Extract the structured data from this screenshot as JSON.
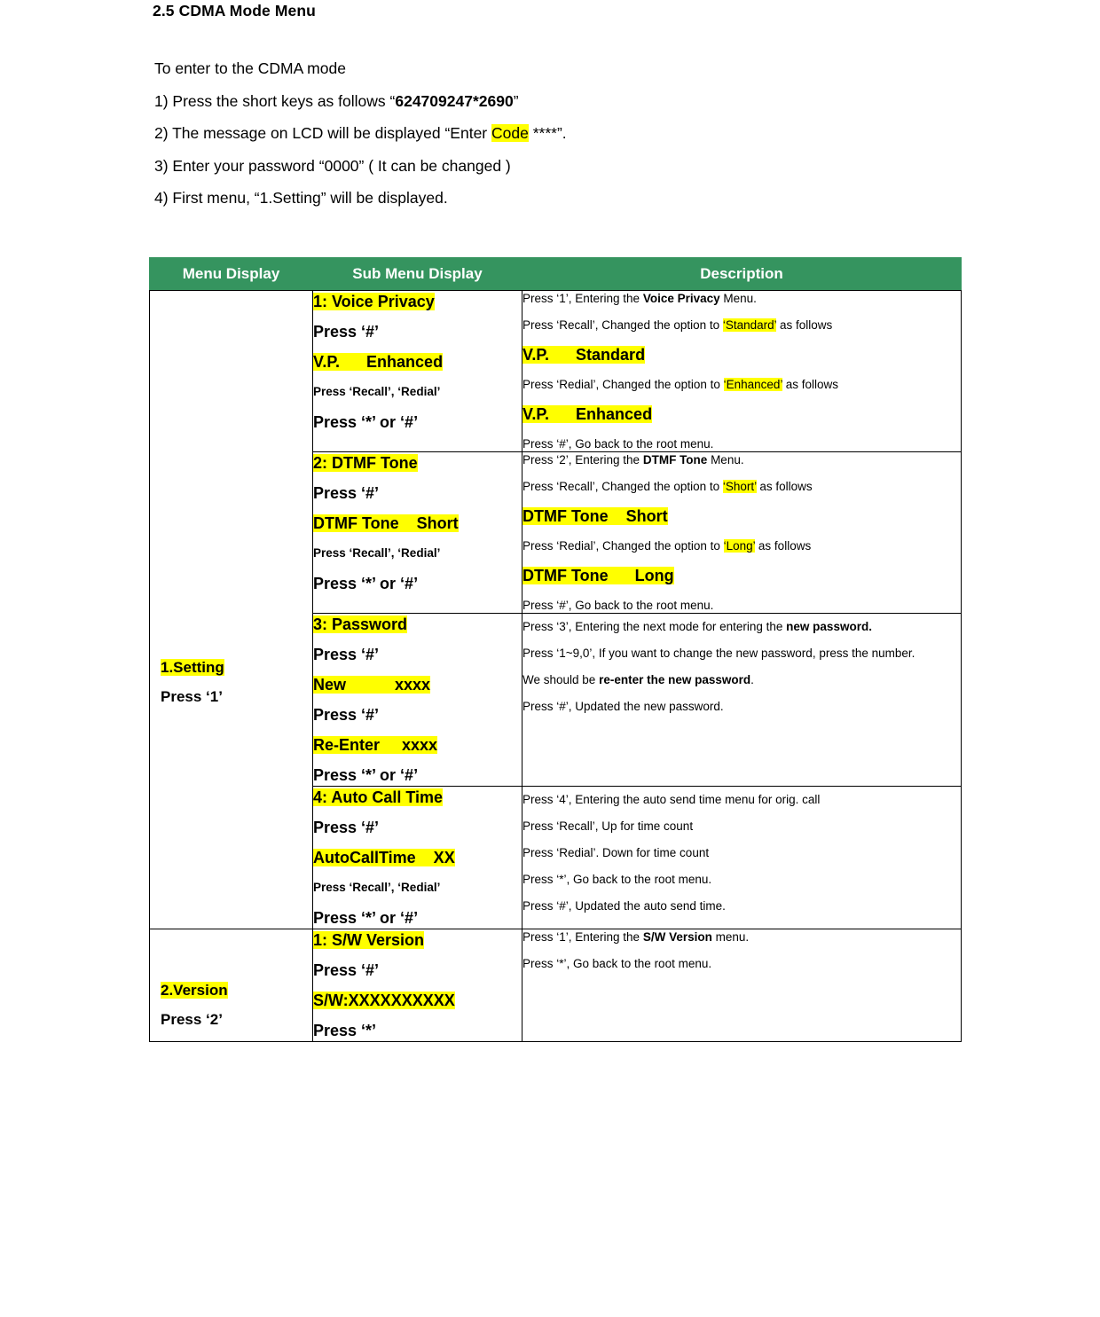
{
  "document": {
    "heading": "2.5 CDMA Mode Menu",
    "intro": {
      "line0": "To enter to the CDMA mode",
      "line1_pre": "1) Press the short keys as follows “",
      "line1_bold": "624709247*2690",
      "line1_post": "”",
      "line2_pre": "2) The message on LCD will be displayed “Enter ",
      "line2_hl": "Code",
      "line2_post": " ****”.",
      "line3": "3) Enter your password “0000” ( It can be changed )",
      "line4": "4) First menu, “1.Setting” will be displayed."
    }
  },
  "table": {
    "headers": {
      "menu": "Menu Display",
      "sub": "Sub Menu Display",
      "desc": "Description"
    },
    "colors": {
      "header_green": "#35945f",
      "highlight_yellow": "#ffff00",
      "border": "#000000"
    },
    "groups": [
      {
        "menu_name": "1.Setting",
        "menu_press": "Press ‘1’",
        "rows": [
          {
            "sub": {
              "l1": "1: Voice Privacy",
              "l2": "Press ‘#’",
              "l3": "V.P.      Enhanced",
              "l4": "Press ‘Recall’, ‘Redial’",
              "l5": "Press ‘*’ or ‘#’"
            },
            "desc": {
              "d1_pre": "Press ‘1’, Entering the ",
              "d1_bold": "Voice Privacy",
              "d1_post": " Menu.",
              "d2_pre": "Press ‘Recall’, Changed the option to ",
              "d2_hl": "‘Standard’",
              "d2_post": " as follows",
              "d3": "V.P.      Standard",
              "d4_pre": "Press ‘Redial’, Changed the option to ",
              "d4_hl": "‘Enhanced’",
              "d4_post": " as follows",
              "d5": "V.P.      Enhanced",
              "d6": "Press ‘#’, Go back to the root menu."
            }
          },
          {
            "sub": {
              "l1": "2: DTMF Tone",
              "l2": "Press ‘#’",
              "l3": "DTMF Tone    Short",
              "l4": "Press ‘Recall’, ‘Redial’",
              "l5": "Press ‘*’ or ‘#’"
            },
            "desc": {
              "d1_pre": "Press ‘2’, Entering the ",
              "d1_bold": "DTMF Tone",
              "d1_post": " Menu.",
              "d2_pre": "Press ‘Recall’, Changed the option to ",
              "d2_hl": "‘Short’",
              "d2_post": " as follows",
              "d3": "DTMF Tone    Short",
              "d4_pre": "Press ‘Redial’, Changed the option to ",
              "d4_hl": "‘Long’",
              "d4_post": " as follows",
              "d5": "DTMF Tone      Long",
              "d6": "Press ‘#’, Go back to the root menu."
            }
          },
          {
            "sub": {
              "l1": "3: Password",
              "l2": "Press ‘#’",
              "l3": "New           xxxx",
              "l4": "Press ‘#’",
              "l5": "Re-Enter     xxxx",
              "l6": "Press ‘*’ or ‘#’"
            },
            "desc": {
              "p1_pre": "Press ‘3’, Entering the next mode for entering the ",
              "p1_bold": "new password.",
              "p2": "Press ‘1~9,0’, If you want to change the new password, press the number.",
              "p3_pre": "We should be ",
              "p3_bold": "re-enter the new password",
              "p3_post": ".",
              "p4": "Press ‘#’, Updated the new password."
            }
          },
          {
            "sub": {
              "l1": "4: Auto Call Time",
              "l2": "Press ‘#’",
              "l3": "AutoCallTime    XX",
              "l4": "Press ‘Recall’, ‘Redial’",
              "l5": "Press ‘*’ or ‘#’"
            },
            "desc": {
              "d1": "Press ‘4’, Entering the auto send time menu for orig. call",
              "d2": "Press ‘Recall’, Up for time count",
              "d3": "Press ‘Redial’. Down for time count",
              "d4": "Press ‘*’, Go back to the root menu.",
              "d5": "Press ‘#’, Updated the auto send time."
            }
          }
        ]
      },
      {
        "menu_name": "2.Version",
        "menu_press": "Press ‘2’",
        "rows": [
          {
            "sub": {
              "l1": "1: S/W Version",
              "l2": "Press ‘#’",
              "l3": "S/W:XXXXXXXXXX",
              "l4": "Press ‘*’"
            },
            "desc": {
              "d1_pre": "Press ‘1’, Entering the ",
              "d1_bold": "S/W Version",
              "d1_post": " menu.",
              "d2": "Press ‘*’, Go back to the root menu."
            }
          }
        ]
      }
    ]
  }
}
